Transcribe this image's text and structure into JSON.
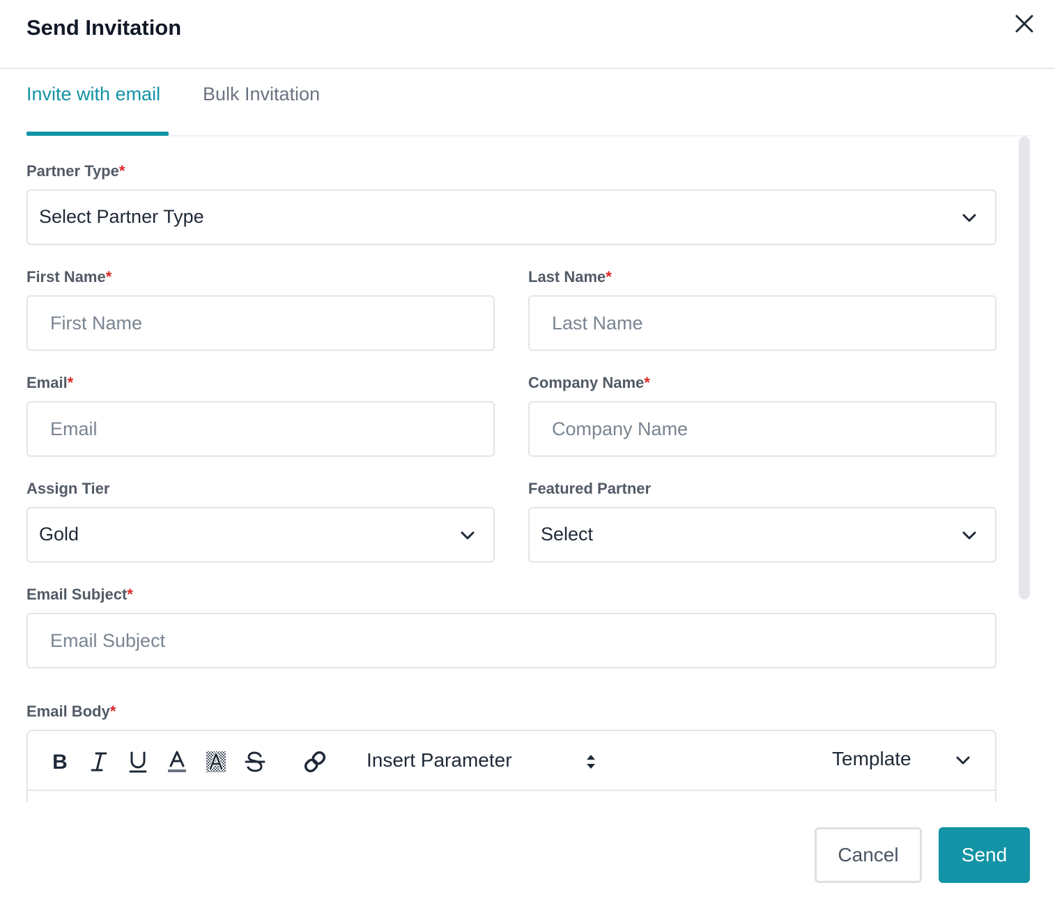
{
  "dialog": {
    "title": "Send Invitation"
  },
  "tabs": [
    {
      "label": "Invite with email",
      "active": true
    },
    {
      "label": "Bulk Invitation",
      "active": false
    }
  ],
  "form": {
    "partner_type": {
      "label": "Partner Type",
      "required_mark": "*",
      "value": "Select Partner Type"
    },
    "first_name": {
      "label": "First Name",
      "required_mark": "*",
      "placeholder": "First Name"
    },
    "last_name": {
      "label": "Last Name",
      "required_mark": "*",
      "placeholder": "Last Name"
    },
    "email": {
      "label": "Email",
      "required_mark": "*",
      "placeholder": "Email"
    },
    "company_name": {
      "label": "Company Name",
      "required_mark": "*",
      "placeholder": "Company Name"
    },
    "assign_tier": {
      "label": "Assign Tier",
      "value": "Gold"
    },
    "featured_partner": {
      "label": "Featured Partner",
      "value": "Select"
    },
    "email_subject": {
      "label": "Email Subject",
      "required_mark": "*",
      "placeholder": "Email Subject"
    },
    "email_body": {
      "label": "Email Body",
      "required_mark": "*"
    }
  },
  "editor_toolbar": {
    "insert_parameter_label": "Insert Parameter",
    "template_label": "Template",
    "icons": [
      "bold-icon",
      "italic-icon",
      "underline-icon",
      "font-color-icon",
      "highlight-icon",
      "strikethrough-icon",
      "link-icon"
    ]
  },
  "footer": {
    "cancel_label": "Cancel",
    "send_label": "Send"
  },
  "colors": {
    "accent": "#1293a6",
    "required": "#dc2626",
    "label": "#525a66",
    "placeholder": "#7a8592"
  }
}
